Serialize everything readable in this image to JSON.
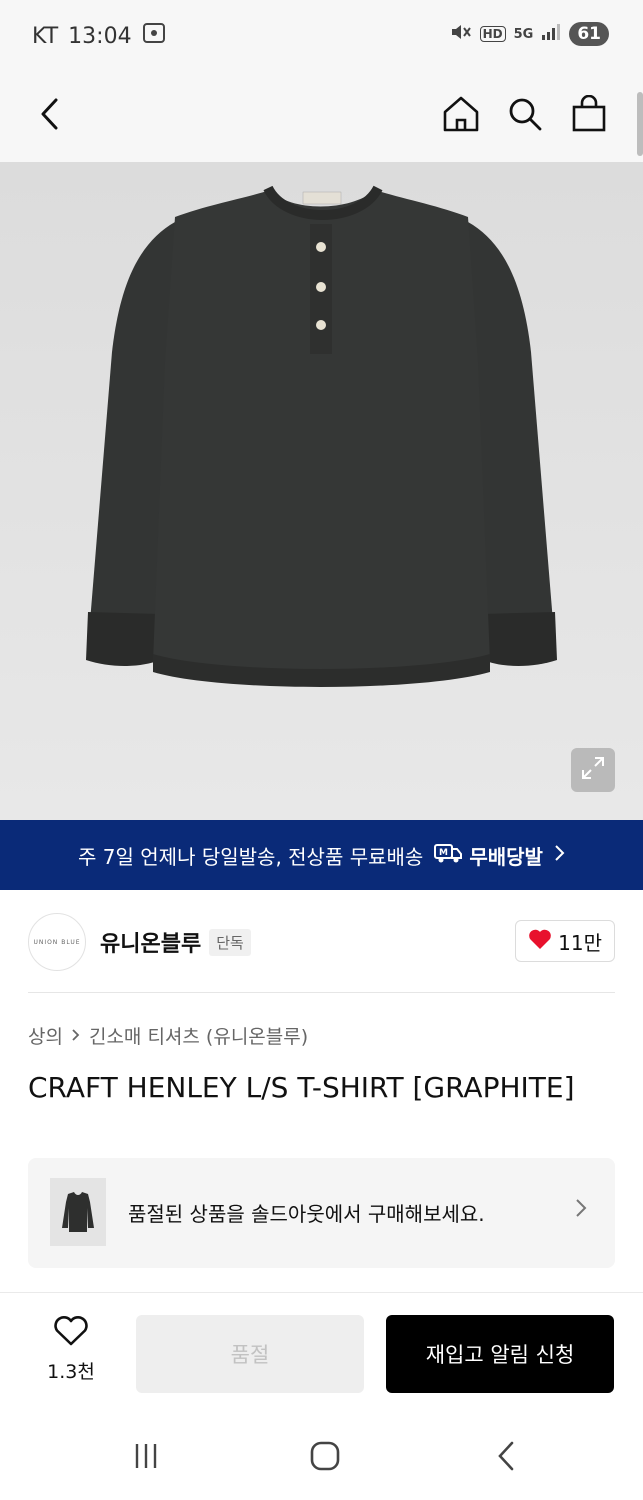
{
  "status_bar": {
    "carrier": "KT",
    "time": "13:04",
    "network": "5G",
    "hd": "HD",
    "battery": "61"
  },
  "header": {
    "back_icon": "back-arrow-icon",
    "home_icon": "home-icon",
    "search_icon": "search-icon",
    "cart_icon": "shopping-bag-icon"
  },
  "delivery_banner": {
    "text": "주 7일 언제나 당일발송, 전상품 무료배송",
    "badge": "무배당발"
  },
  "brand": {
    "logo_text": "UNION BLUE",
    "name": "유니온블루",
    "tag": "단독",
    "likes": "11만"
  },
  "breadcrumb": {
    "level1": "상의",
    "level2": "긴소매 티셔츠 (유니온블루)"
  },
  "product": {
    "title": "CRAFT HENLEY L/S T-SHIRT [GRAPHITE]"
  },
  "soldout_card": {
    "text": "품절된 상품을 솔드아웃에서 구매해보세요."
  },
  "bottom_bar": {
    "wish_count": "1.3천",
    "soldout_label": "품절",
    "restock_label": "재입고 알림 신청"
  },
  "colors": {
    "banner_bg": "#0a2a78",
    "heart": "#e8112d",
    "primary_btn": "#000000"
  }
}
